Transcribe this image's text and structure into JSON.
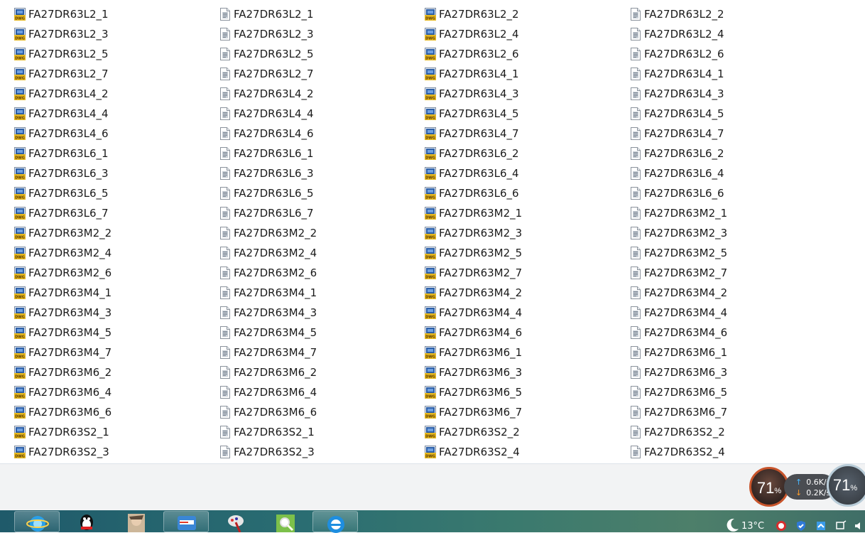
{
  "files": [
    {
      "name": "FA27DR63L2_1",
      "type": "dwg"
    },
    {
      "name": "FA27DR63L2_1",
      "type": "doc"
    },
    {
      "name": "FA27DR63L2_2",
      "type": "dwg"
    },
    {
      "name": "FA27DR63L2_2",
      "type": "doc"
    },
    {
      "name": "FA27DR63L2_3",
      "type": "dwg"
    },
    {
      "name": "FA27DR63L2_3",
      "type": "doc"
    },
    {
      "name": "FA27DR63L2_4",
      "type": "dwg"
    },
    {
      "name": "FA27DR63L2_4",
      "type": "doc"
    },
    {
      "name": "FA27DR63L2_5",
      "type": "dwg"
    },
    {
      "name": "FA27DR63L2_5",
      "type": "doc"
    },
    {
      "name": "FA27DR63L2_6",
      "type": "dwg"
    },
    {
      "name": "FA27DR63L2_6",
      "type": "doc"
    },
    {
      "name": "FA27DR63L2_7",
      "type": "dwg"
    },
    {
      "name": "FA27DR63L2_7",
      "type": "doc"
    },
    {
      "name": "FA27DR63L4_1",
      "type": "dwg"
    },
    {
      "name": "FA27DR63L4_1",
      "type": "doc"
    },
    {
      "name": "FA27DR63L4_2",
      "type": "dwg"
    },
    {
      "name": "FA27DR63L4_2",
      "type": "doc"
    },
    {
      "name": "FA27DR63L4_3",
      "type": "dwg"
    },
    {
      "name": "FA27DR63L4_3",
      "type": "doc"
    },
    {
      "name": "FA27DR63L4_4",
      "type": "dwg"
    },
    {
      "name": "FA27DR63L4_4",
      "type": "doc"
    },
    {
      "name": "FA27DR63L4_5",
      "type": "dwg"
    },
    {
      "name": "FA27DR63L4_5",
      "type": "doc"
    },
    {
      "name": "FA27DR63L4_6",
      "type": "dwg"
    },
    {
      "name": "FA27DR63L4_6",
      "type": "doc"
    },
    {
      "name": "FA27DR63L4_7",
      "type": "dwg"
    },
    {
      "name": "FA27DR63L4_7",
      "type": "doc"
    },
    {
      "name": "FA27DR63L6_1",
      "type": "dwg"
    },
    {
      "name": "FA27DR63L6_1",
      "type": "doc"
    },
    {
      "name": "FA27DR63L6_2",
      "type": "dwg"
    },
    {
      "name": "FA27DR63L6_2",
      "type": "doc"
    },
    {
      "name": "FA27DR63L6_3",
      "type": "dwg"
    },
    {
      "name": "FA27DR63L6_3",
      "type": "doc"
    },
    {
      "name": "FA27DR63L6_4",
      "type": "dwg"
    },
    {
      "name": "FA27DR63L6_4",
      "type": "doc"
    },
    {
      "name": "FA27DR63L6_5",
      "type": "dwg"
    },
    {
      "name": "FA27DR63L6_5",
      "type": "doc"
    },
    {
      "name": "FA27DR63L6_6",
      "type": "dwg"
    },
    {
      "name": "FA27DR63L6_6",
      "type": "doc"
    },
    {
      "name": "FA27DR63L6_7",
      "type": "dwg"
    },
    {
      "name": "FA27DR63L6_7",
      "type": "doc"
    },
    {
      "name": "FA27DR63M2_1",
      "type": "dwg"
    },
    {
      "name": "FA27DR63M2_1",
      "type": "doc"
    },
    {
      "name": "FA27DR63M2_2",
      "type": "dwg"
    },
    {
      "name": "FA27DR63M2_2",
      "type": "doc"
    },
    {
      "name": "FA27DR63M2_3",
      "type": "dwg"
    },
    {
      "name": "FA27DR63M2_3",
      "type": "doc"
    },
    {
      "name": "FA27DR63M2_4",
      "type": "dwg"
    },
    {
      "name": "FA27DR63M2_4",
      "type": "doc"
    },
    {
      "name": "FA27DR63M2_5",
      "type": "dwg"
    },
    {
      "name": "FA27DR63M2_5",
      "type": "doc"
    },
    {
      "name": "FA27DR63M2_6",
      "type": "dwg"
    },
    {
      "name": "FA27DR63M2_6",
      "type": "doc"
    },
    {
      "name": "FA27DR63M2_7",
      "type": "dwg"
    },
    {
      "name": "FA27DR63M2_7",
      "type": "doc"
    },
    {
      "name": "FA27DR63M4_1",
      "type": "dwg"
    },
    {
      "name": "FA27DR63M4_1",
      "type": "doc"
    },
    {
      "name": "FA27DR63M4_2",
      "type": "dwg"
    },
    {
      "name": "FA27DR63M4_2",
      "type": "doc"
    },
    {
      "name": "FA27DR63M4_3",
      "type": "dwg"
    },
    {
      "name": "FA27DR63M4_3",
      "type": "doc"
    },
    {
      "name": "FA27DR63M4_4",
      "type": "dwg"
    },
    {
      "name": "FA27DR63M4_4",
      "type": "doc"
    },
    {
      "name": "FA27DR63M4_5",
      "type": "dwg"
    },
    {
      "name": "FA27DR63M4_5",
      "type": "doc"
    },
    {
      "name": "FA27DR63M4_6",
      "type": "dwg"
    },
    {
      "name": "FA27DR63M4_6",
      "type": "doc"
    },
    {
      "name": "FA27DR63M4_7",
      "type": "dwg"
    },
    {
      "name": "FA27DR63M4_7",
      "type": "doc"
    },
    {
      "name": "FA27DR63M6_1",
      "type": "dwg"
    },
    {
      "name": "FA27DR63M6_1",
      "type": "doc"
    },
    {
      "name": "FA27DR63M6_2",
      "type": "dwg"
    },
    {
      "name": "FA27DR63M6_2",
      "type": "doc"
    },
    {
      "name": "FA27DR63M6_3",
      "type": "dwg"
    },
    {
      "name": "FA27DR63M6_3",
      "type": "doc"
    },
    {
      "name": "FA27DR63M6_4",
      "type": "dwg"
    },
    {
      "name": "FA27DR63M6_4",
      "type": "doc"
    },
    {
      "name": "FA27DR63M6_5",
      "type": "dwg"
    },
    {
      "name": "FA27DR63M6_5",
      "type": "doc"
    },
    {
      "name": "FA27DR63M6_6",
      "type": "dwg"
    },
    {
      "name": "FA27DR63M6_6",
      "type": "doc"
    },
    {
      "name": "FA27DR63M6_7",
      "type": "dwg"
    },
    {
      "name": "FA27DR63M6_7",
      "type": "doc"
    },
    {
      "name": "FA27DR63S2_1",
      "type": "dwg"
    },
    {
      "name": "FA27DR63S2_1",
      "type": "doc"
    },
    {
      "name": "FA27DR63S2_2",
      "type": "dwg"
    },
    {
      "name": "FA27DR63S2_2",
      "type": "doc"
    },
    {
      "name": "FA27DR63S2_3",
      "type": "dwg"
    },
    {
      "name": "FA27DR63S2_3",
      "type": "doc"
    },
    {
      "name": "FA27DR63S2_4",
      "type": "dwg"
    },
    {
      "name": "FA27DR63S2_4",
      "type": "doc"
    }
  ],
  "icons": {
    "dwg": "dwg-file-icon",
    "doc": "text-file-icon"
  },
  "monitor": {
    "cpu_value": "71",
    "cpu_unit": "%",
    "upload": "0.6",
    "upload_unit": "K/s",
    "download": "0.2",
    "download_unit": "K/s",
    "mem_value": "71",
    "mem_unit": "%"
  },
  "taskbar": {
    "apps": [
      "ie-browser-icon",
      "qq-icon",
      "avatar-app-icon",
      "vpn-app-icon",
      "paint-app-icon",
      "image-viewer-icon",
      "internet-explorer-icon"
    ],
    "temperature": "13°C"
  },
  "colors": {
    "accent_orange": "#c8552c",
    "taskbar": "#2a6d72",
    "dwg_blue": "#2c5fa8",
    "dwg_yellow": "#e6b820"
  }
}
